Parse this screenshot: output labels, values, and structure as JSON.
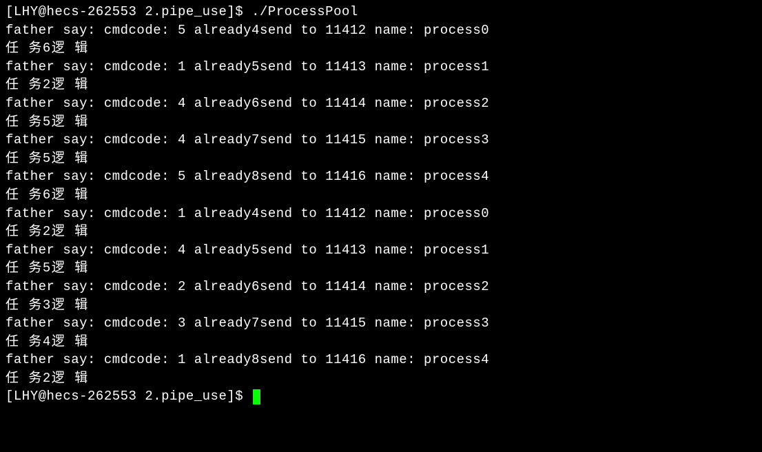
{
  "prompt1": {
    "text": "[LHY@hecs-262553 2.pipe_use]$ ",
    "command": "./ProcessPool"
  },
  "output": [
    {
      "father": "father say: cmdcode: 5 already4send to 11412 name: process0",
      "task": "任 务6逻 辑"
    },
    {
      "father": "father say: cmdcode: 1 already5send to 11413 name: process1",
      "task": "任 务2逻 辑"
    },
    {
      "father": "father say: cmdcode: 4 already6send to 11414 name: process2",
      "task": "任 务5逻 辑"
    },
    {
      "father": "father say: cmdcode: 4 already7send to 11415 name: process3",
      "task": "任 务5逻 辑"
    },
    {
      "father": "father say: cmdcode: 5 already8send to 11416 name: process4",
      "task": "任 务6逻 辑"
    },
    {
      "father": "father say: cmdcode: 1 already4send to 11412 name: process0",
      "task": "任 务2逻 辑"
    },
    {
      "father": "father say: cmdcode: 4 already5send to 11413 name: process1",
      "task": "任 务5逻 辑"
    },
    {
      "father": "father say: cmdcode: 2 already6send to 11414 name: process2",
      "task": "任 务3逻 辑"
    },
    {
      "father": "father say: cmdcode: 3 already7send to 11415 name: process3",
      "task": "任 务4逻 辑"
    },
    {
      "father": "father say: cmdcode: 1 already8send to 11416 name: process4",
      "task": "任 务2逻 辑"
    }
  ],
  "prompt2": {
    "text": "[LHY@hecs-262553 2.pipe_use]$ "
  }
}
